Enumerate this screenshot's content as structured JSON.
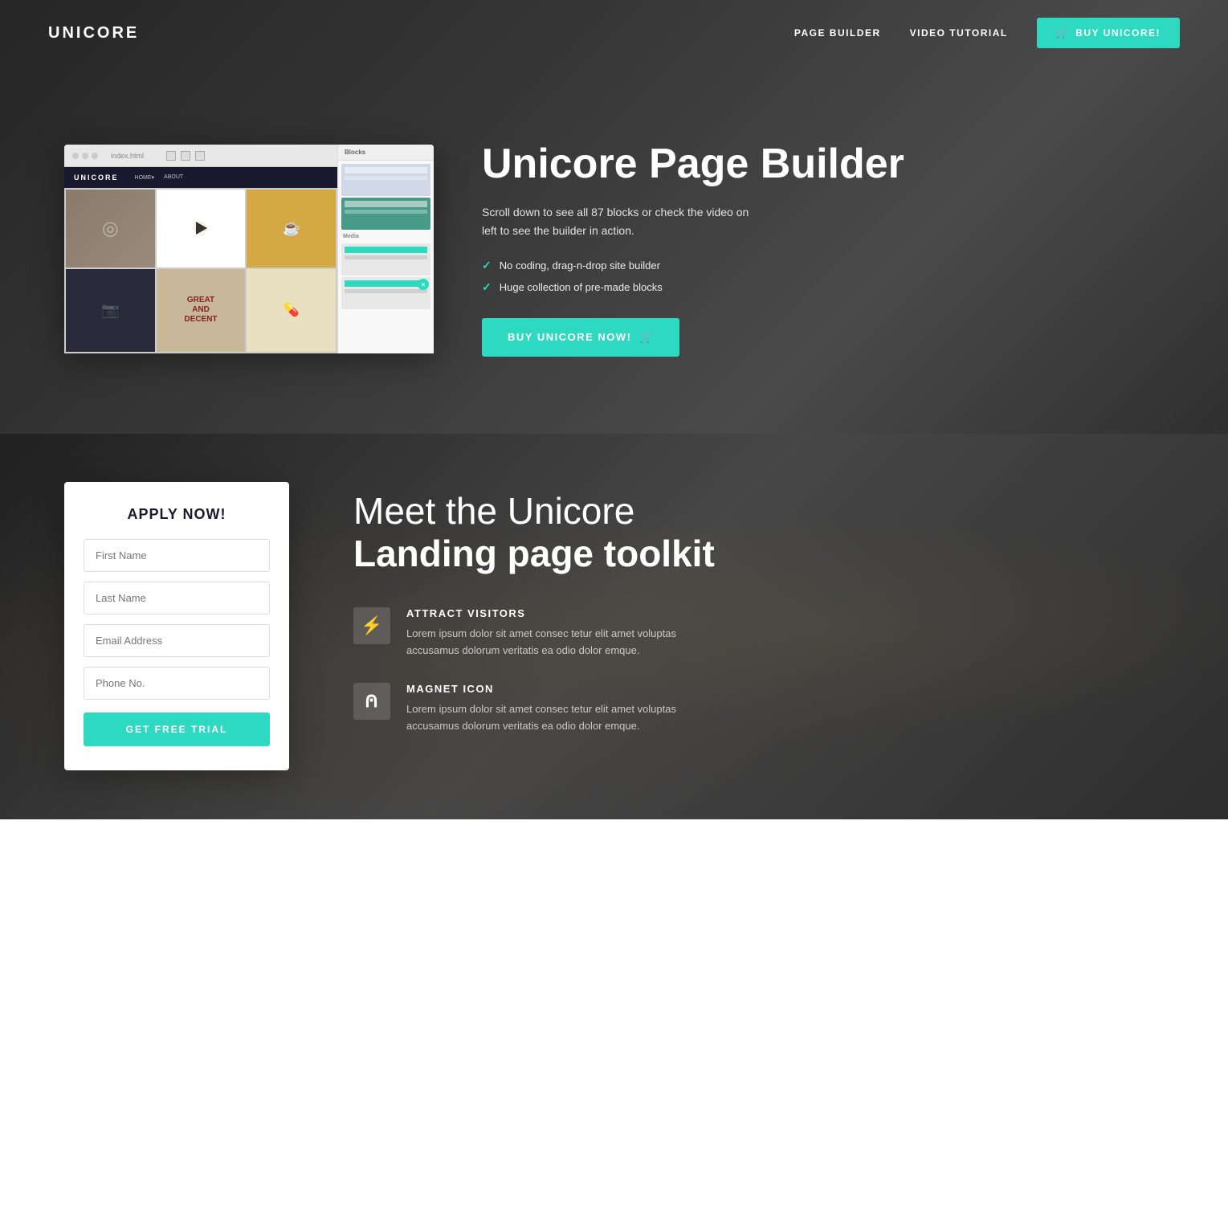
{
  "navbar": {
    "logo": "UNICORE",
    "links": [
      {
        "label": "PAGE BUILDER",
        "id": "page-builder-link"
      },
      {
        "label": "VIDEO TUTORIAL",
        "id": "video-tutorial-link"
      }
    ],
    "cta_label": "BUY UNICORE!",
    "cta_icon": "cart-icon"
  },
  "hero": {
    "title": "Unicore Page Builder",
    "subtitle": "Scroll down to see all 87 blocks or check the video on left to see the builder in action.",
    "features": [
      "No coding, drag-n-drop site builder",
      "Huge collection of pre-made blocks"
    ],
    "cta_label": "BUY UNICORE NOW!",
    "cta_icon": "cart-icon",
    "browser_mock": {
      "url": "index.html",
      "inner_logo": "UNICORE",
      "inner_links": [
        "HOME▾",
        "ABOUT"
      ],
      "blocks_label": "Blocks",
      "media_label": "Media"
    }
  },
  "apply_form": {
    "title": "APPLY NOW!",
    "fields": [
      {
        "placeholder": "First Name",
        "type": "text",
        "id": "first-name"
      },
      {
        "placeholder": "Last Name",
        "type": "text",
        "id": "last-name"
      },
      {
        "placeholder": "Email Address",
        "type": "email",
        "id": "email"
      },
      {
        "placeholder": "Phone No.",
        "type": "tel",
        "id": "phone"
      }
    ],
    "submit_label": "GET FREE TRIAL"
  },
  "meet_section": {
    "title_line1": "Meet the Unicore",
    "title_line2": "Landing page toolkit",
    "features": [
      {
        "id": "attract-visitors",
        "icon": "⚡",
        "name": "ATTRACT VISITORS",
        "description": "Lorem ipsum dolor sit amet consec tetur elit amet voluptas accusamus dolorum veritatis ea odio dolor emque."
      },
      {
        "id": "magnet-icon",
        "icon": "⚲",
        "name": "MAGNET ICON",
        "description": "Lorem ipsum dolor sit amet consec tetur elit amet voluptas accusamus dolorum veritatis ea odio dolor emque."
      }
    ]
  },
  "colors": {
    "accent": "#2dd9c0",
    "dark": "#1a1a2e",
    "text_light": "rgba(255,255,255,0.85)"
  }
}
